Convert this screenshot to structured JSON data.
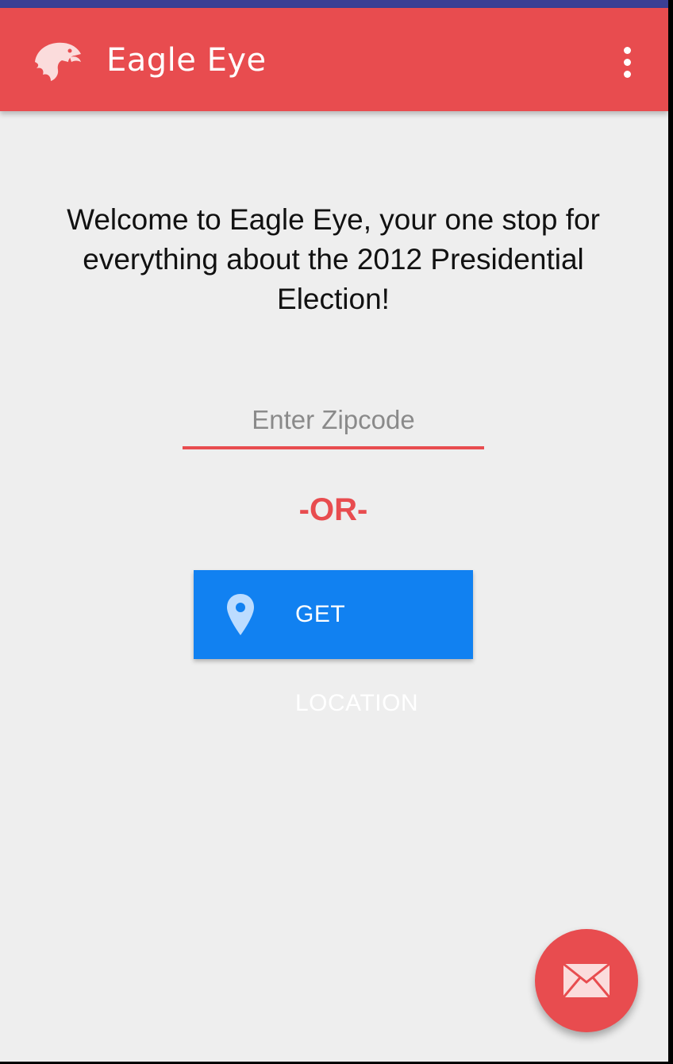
{
  "app_bar": {
    "title": "Eagle Eye",
    "logo_icon": "eagle-head-icon",
    "menu_icon": "overflow-menu-icon",
    "background_color": "#e84c4f"
  },
  "main": {
    "welcome_text": "Welcome to Eagle Eye, your one stop for everything about the 2012 Presidential Election!",
    "zipcode_input": {
      "placeholder": "Enter Zipcode",
      "value": ""
    },
    "or_label": "-OR-",
    "location_button": {
      "label": "GET LOCATION",
      "icon": "location-pin-icon",
      "color": "#1181f1"
    }
  },
  "fab": {
    "icon": "mail-icon",
    "color": "#e84c4f"
  }
}
